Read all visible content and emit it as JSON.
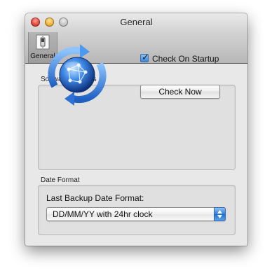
{
  "window": {
    "title": "General"
  },
  "toolbar": {
    "items": [
      {
        "label": "General",
        "icon": "light-switch-icon"
      }
    ]
  },
  "software_updates": {
    "group_label": "Software Updates",
    "icon": "software-update-globe-icon",
    "check_on_startup": {
      "label": "Check On Startup",
      "checked": true
    },
    "check_now_label": "Check Now"
  },
  "date_format": {
    "group_label": "Date Format",
    "field_label": "Last Backup Date Format:",
    "selected": "DD/MM/YY with 24hr clock"
  },
  "colors": {
    "accent": "#3c84d6",
    "close_light": "#e0463a",
    "minimize_light": "#f2b134",
    "zoom_light": "#c5c5c5"
  }
}
